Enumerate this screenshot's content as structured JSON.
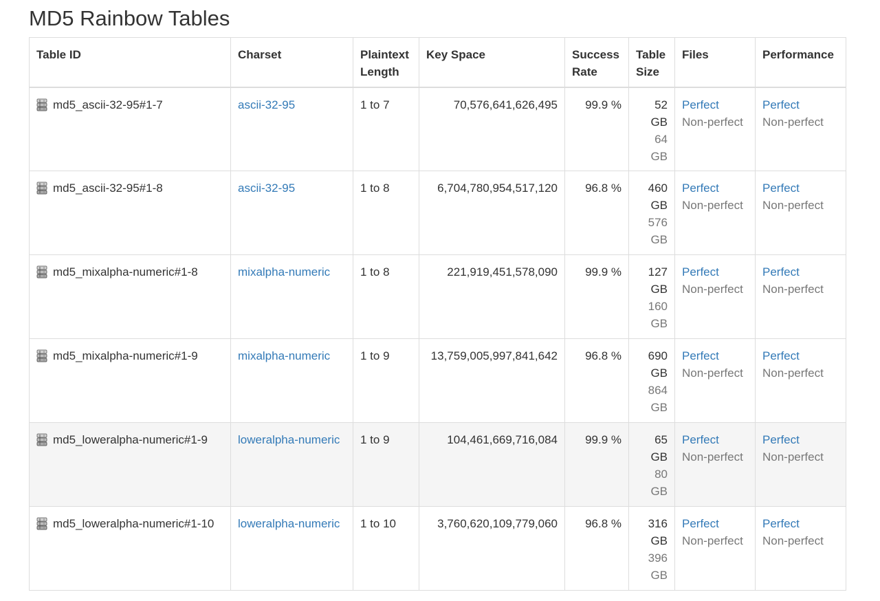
{
  "page": {
    "title": "MD5 Rainbow Tables"
  },
  "table": {
    "headers": {
      "table_id": "Table ID",
      "charset": "Charset",
      "plaintext_length": "Plaintext Length",
      "key_space": "Key Space",
      "success_rate": "Success Rate",
      "table_size": "Table Size",
      "files": "Files",
      "performance": "Performance"
    },
    "rows": [
      {
        "id": "md5_ascii-32-95#1-7",
        "charset": "ascii-32-95",
        "length": "1 to 7",
        "key_space": "70,576,641,626,495",
        "success_rate": "99.9 %",
        "size_perfect": "52 GB",
        "size_nonperfect": "64 GB",
        "files_perfect": "Perfect",
        "files_nonperfect": "Non-perfect",
        "perf_perfect": "Perfect",
        "perf_nonperfect": "Non-perfect"
      },
      {
        "id": "md5_ascii-32-95#1-8",
        "charset": "ascii-32-95",
        "length": "1 to 8",
        "key_space": "6,704,780,954,517,120",
        "success_rate": "96.8 %",
        "size_perfect": "460 GB",
        "size_nonperfect": "576 GB",
        "files_perfect": "Perfect",
        "files_nonperfect": "Non-perfect",
        "perf_perfect": "Perfect",
        "perf_nonperfect": "Non-perfect"
      },
      {
        "id": "md5_mixalpha-numeric#1-8",
        "charset": "mixalpha-numeric",
        "length": "1 to 8",
        "key_space": "221,919,451,578,090",
        "success_rate": "99.9 %",
        "size_perfect": "127 GB",
        "size_nonperfect": "160 GB",
        "files_perfect": "Perfect",
        "files_nonperfect": "Non-perfect",
        "perf_perfect": "Perfect",
        "perf_nonperfect": "Non-perfect"
      },
      {
        "id": "md5_mixalpha-numeric#1-9",
        "charset": "mixalpha-numeric",
        "length": "1 to 9",
        "key_space": "13,759,005,997,841,642",
        "success_rate": "96.8 %",
        "size_perfect": "690 GB",
        "size_nonperfect": "864 GB",
        "files_perfect": "Perfect",
        "files_nonperfect": "Non-perfect",
        "perf_perfect": "Perfect",
        "perf_nonperfect": "Non-perfect"
      },
      {
        "id": "md5_loweralpha-numeric#1-9",
        "charset": "loweralpha-numeric",
        "length": "1 to 9",
        "key_space": "104,461,669,716,084",
        "success_rate": "99.9 %",
        "size_perfect": "65 GB",
        "size_nonperfect": "80 GB",
        "files_perfect": "Perfect",
        "files_nonperfect": "Non-perfect",
        "perf_perfect": "Perfect",
        "perf_nonperfect": "Non-perfect"
      },
      {
        "id": "md5_loweralpha-numeric#1-10",
        "charset": "loweralpha-numeric",
        "length": "1 to 10",
        "key_space": "3,760,620,109,779,060",
        "success_rate": "96.8 %",
        "size_perfect": "316 GB",
        "size_nonperfect": "396 GB",
        "files_perfect": "Perfect",
        "files_nonperfect": "Non-perfect",
        "perf_perfect": "Perfect",
        "perf_nonperfect": "Non-perfect"
      }
    ]
  },
  "icons": {
    "row_icon": "database-icon"
  },
  "colors": {
    "link": "#337ab7",
    "muted": "#777777",
    "text": "#333333",
    "border": "#dddddd",
    "highlight_row": "#f5f5f5"
  }
}
